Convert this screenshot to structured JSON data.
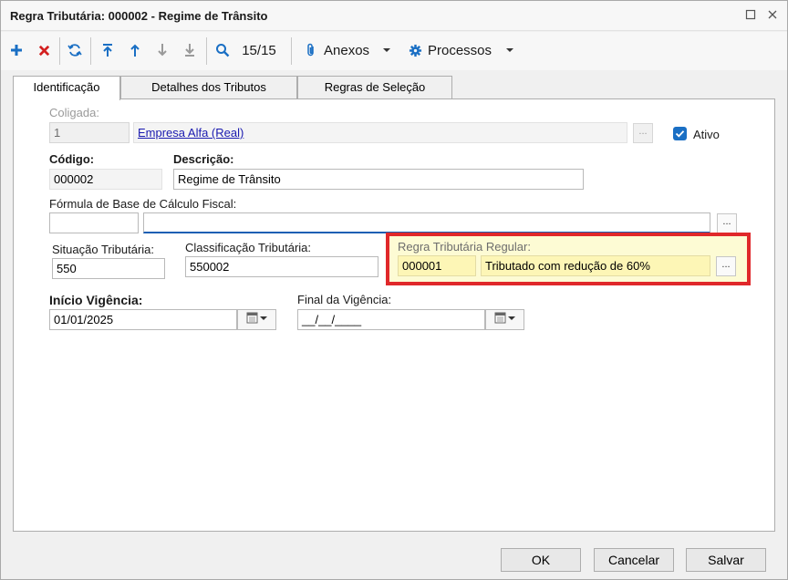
{
  "window": {
    "title": "Regra Tributária: 000002 - Regime de Trânsito"
  },
  "toolbar": {
    "record_counter": "15/15",
    "attachments_label": "Anexos",
    "processes_label": "Processos",
    "icons": [
      "plus-icon",
      "delete-icon",
      "refresh-icon",
      "first-record-icon",
      "previous-record-icon",
      "next-record-icon",
      "last-record-icon",
      "search-icon",
      "paperclip-icon",
      "gear-icon"
    ]
  },
  "tabs": [
    {
      "label": "Identificação",
      "active": true
    },
    {
      "label": "Detalhes dos Tributos",
      "active": false
    },
    {
      "label": "Regras de Seleção",
      "active": false
    }
  ],
  "form": {
    "coligada_label": "Coligada:",
    "coligada_code": "1",
    "coligada_name": "Empresa Alfa (Real)",
    "ativo_label": "Ativo",
    "ativo_checked": true,
    "codigo_label": "Código:",
    "codigo_value": "000002",
    "descricao_label": "Descrição:",
    "descricao_value": "Regime de Trânsito",
    "formula_label": "Fórmula de Base de Cálculo Fiscal:",
    "formula_code": "",
    "formula_value": "",
    "situacao_label": "Situação Tributária:",
    "situacao_value": "550",
    "classificacao_label": "Classificação Tributária:",
    "classificacao_value": "550002",
    "regra_regular_label": "Regra Tributária Regular:",
    "regra_regular_code": "000001",
    "regra_regular_desc": "Tributado com redução de 60%",
    "inicio_label": "Início Vigência:",
    "inicio_value": "01/01/2025",
    "final_label": "Final da Vigência:",
    "final_value": "__/__/____",
    "lookup_button": "..."
  },
  "footer": {
    "ok_label": "OK",
    "cancel_label": "Cancelar",
    "save_label": "Salvar"
  },
  "colors": {
    "highlight_border": "#e0282a",
    "highlight_fill": "#fdfbd4",
    "accent_blue": "#1a6fc4",
    "delete_red": "#d32020"
  }
}
